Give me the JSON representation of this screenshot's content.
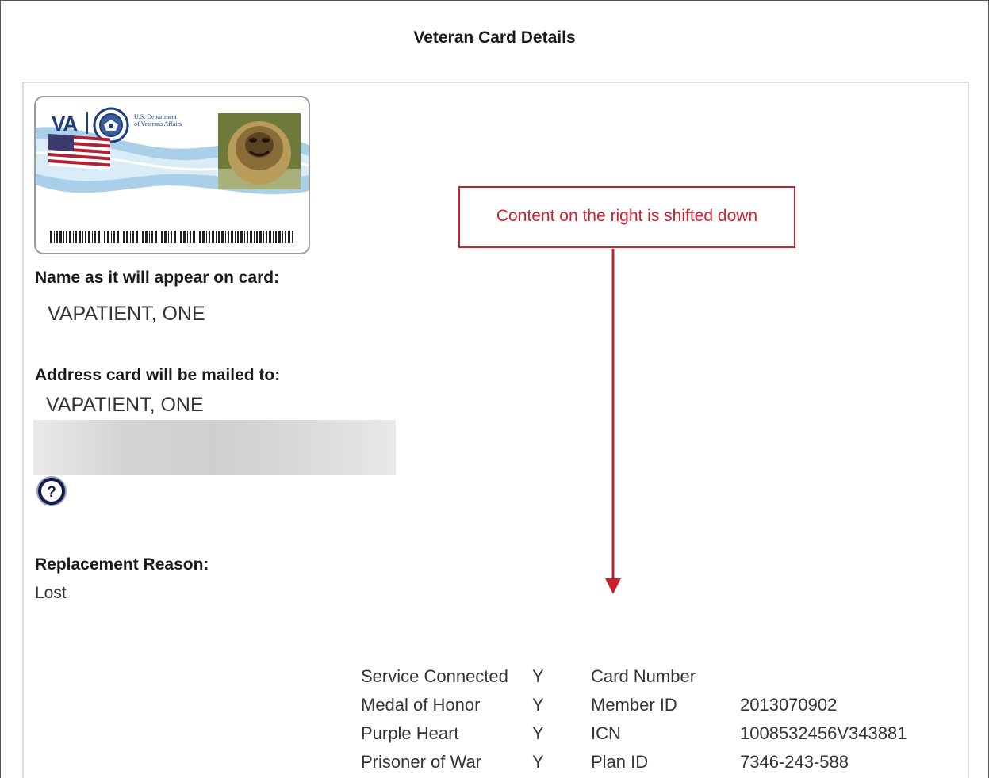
{
  "page": {
    "title": "Veteran Card Details"
  },
  "card": {
    "logo_text": "VA",
    "department_line1": "U.S. Department",
    "department_line2": "of Veterans Affairs"
  },
  "name_section": {
    "label": "Name as it will appear on card:",
    "value": "VAPATIENT, ONE"
  },
  "address_section": {
    "label": "Address card will be mailed to:",
    "value": "VAPATIENT, ONE"
  },
  "replacement": {
    "label": "Replacement Reason:",
    "value": "Lost"
  },
  "annotation": {
    "text": "Content on the right is shifted down",
    "color": "#d21f2d"
  },
  "details": {
    "rows": [
      {
        "flag_label": "Service Connected",
        "flag_value": "Y",
        "field_label": "Card Number",
        "field_value": ""
      },
      {
        "flag_label": "Medal of Honor",
        "flag_value": "Y",
        "field_label": "Member ID",
        "field_value": "2013070902"
      },
      {
        "flag_label": "Purple Heart",
        "flag_value": "Y",
        "field_label": "ICN",
        "field_value": "1008532456V343881"
      },
      {
        "flag_label": "Prisoner of War",
        "flag_value": "Y",
        "field_label": "Plan ID",
        "field_value": "7346-243-588"
      }
    ]
  },
  "icons": {
    "help": "question-mark-icon",
    "seal": "va-seal-icon",
    "flag": "us-flag-icon",
    "arrow": "arrow-down-icon"
  }
}
